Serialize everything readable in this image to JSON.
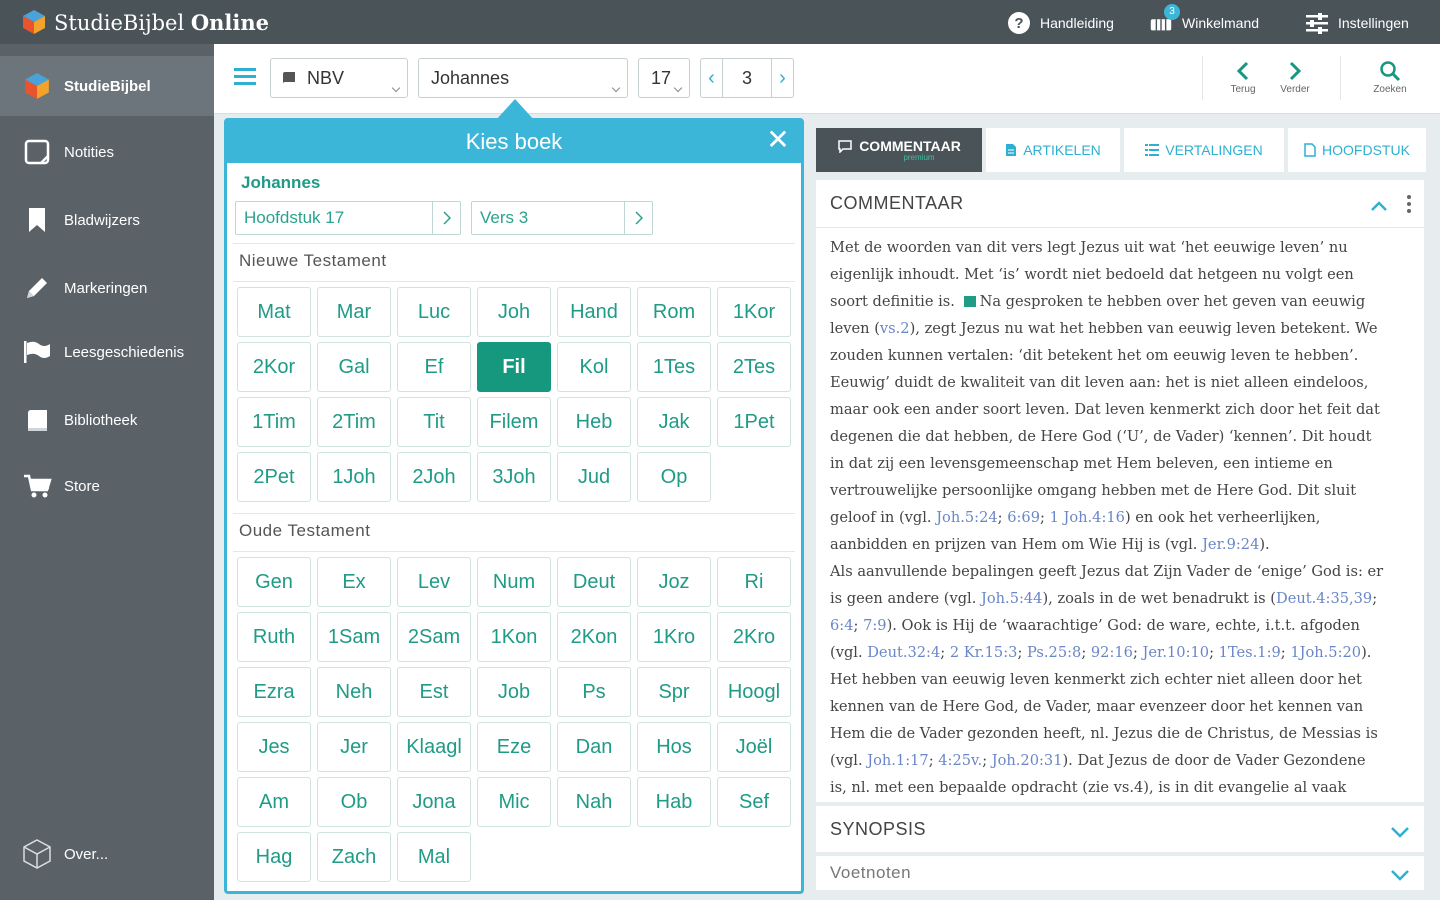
{
  "app": {
    "title_part1": "StudieBijbel",
    "title_part2": "Online",
    "header_actions": [
      {
        "label": "Handleiding",
        "icon": "help-circle-icon"
      },
      {
        "label": "Winkelmand",
        "icon": "cart-icon",
        "badge": "3"
      },
      {
        "label": "Instellingen",
        "icon": "sliders-icon"
      }
    ]
  },
  "sidebar": {
    "items": [
      {
        "label": "StudieBijbel",
        "icon": "cube-logo-icon",
        "active": true
      },
      {
        "label": "Notities",
        "icon": "note-icon"
      },
      {
        "label": "Bladwijzers",
        "icon": "bookmark-icon"
      },
      {
        "label": "Markeringen",
        "icon": "pencil-icon"
      },
      {
        "label": "Leesgeschiedenis",
        "icon": "flag-icon"
      },
      {
        "label": "Bibliotheek",
        "icon": "book-icon"
      },
      {
        "label": "Store",
        "icon": "cart-icon"
      }
    ],
    "footer": {
      "label": "Over...",
      "icon": "cube-outline-icon"
    }
  },
  "toolbar": {
    "translation": "NBV",
    "book": "Johannes",
    "chapter": "17",
    "verse": "3",
    "back_label": "Terug",
    "forward_label": "Verder",
    "search_label": "Zoeken"
  },
  "picker": {
    "title": "Kies boek",
    "current_book": "Johannes",
    "chapter_select": "Hoofdstuk 17",
    "verse_select": "Vers 3",
    "nt_title": "Nieuwe Testament",
    "ot_title": "Oude Testament",
    "nt_books": [
      "Mat",
      "Mar",
      "Luc",
      "Joh",
      "Hand",
      "Rom",
      "1Kor",
      "2Kor",
      "Gal",
      "Ef",
      "Fil",
      "Kol",
      "1Tes",
      "2Tes",
      "1Tim",
      "2Tim",
      "Tit",
      "Filem",
      "Heb",
      "Jak",
      "1Pet",
      "2Pet",
      "1Joh",
      "2Joh",
      "3Joh",
      "Jud",
      "Op"
    ],
    "ot_books": [
      "Gen",
      "Ex",
      "Lev",
      "Num",
      "Deut",
      "Joz",
      "Ri",
      "Ruth",
      "1Sam",
      "2Sam",
      "1Kon",
      "2Kon",
      "1Kro",
      "2Kro",
      "Ezra",
      "Neh",
      "Est",
      "Job",
      "Ps",
      "Spr",
      "Hoogl",
      "Jes",
      "Jer",
      "Klaagl",
      "Eze",
      "Dan",
      "Hos",
      "Joël",
      "Am",
      "Ob",
      "Jona",
      "Mic",
      "Nah",
      "Hab",
      "Sef",
      "Hag",
      "Zach",
      "Mal"
    ],
    "selected_book": "Fil"
  },
  "right_panel": {
    "tabs": [
      {
        "label": "COMMENTAAR",
        "sub": "premium",
        "active": true
      },
      {
        "label": "ARTIKELEN"
      },
      {
        "label": "VERTALINGEN"
      },
      {
        "label": "HOOFDSTUK"
      }
    ],
    "commentary_title": "COMMENTAAR",
    "commentary_lines": [
      [
        {
          "t": "Met de woorden van dit vers legt Jezus uit wat ‘het eeuwige leven’ nu"
        }
      ],
      [
        {
          "t": "eigenlijk inhoudt. Met ‘is’ wordt niet bedoeld dat hetgeen nu volgt een"
        }
      ],
      [
        {
          "t": "soort definitie is. "
        },
        {
          "mark": true
        },
        {
          "t": "Na gesproken te hebben over het geven van eeuwig"
        }
      ],
      [
        {
          "t": "leven ("
        },
        {
          "r": "vs.2"
        },
        {
          "t": "), zegt Jezus nu wat het hebben van eeuwig leven betekent. We"
        }
      ],
      [
        {
          "t": "zouden kunnen vertalen: ‘dit betekent het om eeuwig leven te hebben’."
        }
      ],
      [
        {
          "t": "Eeuwig’ duidt de kwaliteit van dit leven aan: het is niet alleen eindeloos,"
        }
      ],
      [
        {
          "t": "maar ook een ander soort leven. Dat leven kenmerkt zich door het feit dat"
        }
      ],
      [
        {
          "t": "degenen die dat hebben, de Here God (‘U’, de Vader) ‘kennen’. Dit houdt"
        }
      ],
      [
        {
          "t": "in dat zij een levensgemeenschap met Hem beleven, een intieme en"
        }
      ],
      [
        {
          "t": "vertrouwelijke persoonlijke omgang hebben met de Here God. Dit sluit"
        }
      ],
      [
        {
          "t": "geloof in (vgl. "
        },
        {
          "r": "Joh.5:24"
        },
        {
          "t": "; "
        },
        {
          "r": "6:69"
        },
        {
          "t": "; "
        },
        {
          "r": "1 Joh.4:16"
        },
        {
          "t": ") en ook het verheerlijken,"
        }
      ],
      [
        {
          "t": "aanbidden en prijzen van Hem om Wie Hij is (vgl. "
        },
        {
          "r": "Jer.9:24"
        },
        {
          "t": ")."
        }
      ],
      [
        {
          "t": "Als aanvullende bepalingen geeft Jezus dat Zijn Vader de ‘enige’ God is: er"
        }
      ],
      [
        {
          "t": "is geen andere (vgl. "
        },
        {
          "r": "Joh.5:44"
        },
        {
          "t": "), zoals in de wet benadrukt is ("
        },
        {
          "r": "Deut.4:35,39"
        },
        {
          "t": ";"
        }
      ],
      [
        {
          "r": "6:4"
        },
        {
          "t": "; "
        },
        {
          "r": "7:9"
        },
        {
          "t": "). Ook is Hij de ‘waarachtige’ God: de ware, echte, i.t.t. afgoden"
        }
      ],
      [
        {
          "t": "(vgl. "
        },
        {
          "r": "Deut.32:4"
        },
        {
          "t": "; "
        },
        {
          "r": "2 Kr.15:3"
        },
        {
          "t": "; "
        },
        {
          "r": "Ps.25:8"
        },
        {
          "t": "; "
        },
        {
          "r": "92:16"
        },
        {
          "t": "; "
        },
        {
          "r": "Jer.10:10"
        },
        {
          "t": "; "
        },
        {
          "r": "1Tes.1:9"
        },
        {
          "t": "; "
        },
        {
          "r": "1Joh.5:20"
        },
        {
          "t": ")."
        }
      ],
      [
        {
          "t": "Het hebben van eeuwig leven kenmerkt zich echter niet alleen door het"
        }
      ],
      [
        {
          "t": "kennen van de Here God, de Vader, maar evenzeer door het kennen van"
        }
      ],
      [
        {
          "t": "Hem die de Vader gezonden heeft, nl. Jezus die de Christus, de Messias is"
        }
      ],
      [
        {
          "t": "(vgl. "
        },
        {
          "r": "Joh.1:17"
        },
        {
          "t": "; "
        },
        {
          "r": "4:25v."
        },
        {
          "t": "; "
        },
        {
          "r": "Joh.20:31"
        },
        {
          "t": "). Dat Jezus de door de Vader Gezondene"
        }
      ],
      [
        {
          "t": "is, nl. met een bepaalde opdracht (zie vs.4), is in dit evangelie al vaak"
        }
      ]
    ],
    "synopsis_title": "SYNOPSIS",
    "footnotes_title": "Voetnoten"
  },
  "colors": {
    "accent": "#3cb6d8",
    "green": "#16987f",
    "topbar": "#4a5358",
    "sidebar": "#5a6268"
  }
}
